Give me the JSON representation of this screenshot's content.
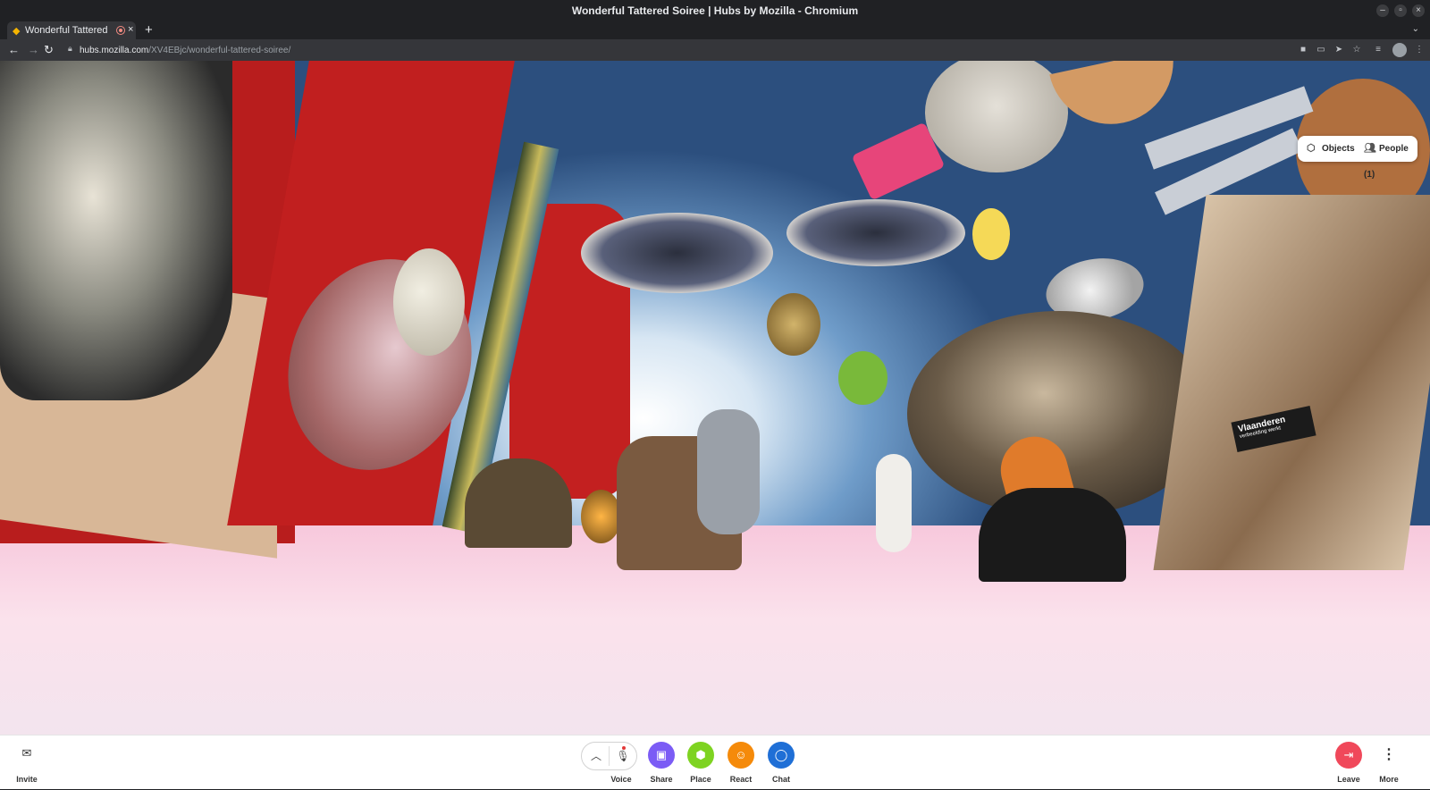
{
  "window": {
    "title": "Wonderful Tattered Soiree | Hubs by Mozilla - Chromium"
  },
  "tab": {
    "label": "Wonderful Tattered Soiree | Hubs by Mozilla"
  },
  "address": {
    "host": "hubs.mozilla.com",
    "path": "/XV4EBjc/wonderful-tattered-soiree/"
  },
  "panel": {
    "objects_label": "Objects",
    "people_label": "People (1)"
  },
  "bottom_bar": {
    "invite_label": "Invite",
    "voice_label": "Voice",
    "share_label": "Share",
    "place_label": "Place",
    "react_label": "React",
    "chat_label": "Chat",
    "leave_label": "Leave",
    "more_label": "More"
  },
  "scene": {
    "sign_text": "Vlaanderen",
    "sign_subtext": "verbeelding werkt"
  },
  "colors": {
    "share": "#7b5cf5",
    "place": "#7ed321",
    "react": "#f58a0a",
    "chat": "#1f6fd6",
    "leave": "#f0485a",
    "floor": "#f7c8dc",
    "sky": "#2c4f7e"
  },
  "icons": {
    "invite": "envelope-icon",
    "voice_toggle": "chevron-up-icon",
    "voice": "muted-microphone-icon",
    "share": "screen-share-icon",
    "place": "cube-icon",
    "react": "smiley-icon",
    "chat": "chat-bubble-icon",
    "leave": "exit-door-icon",
    "more": "vertical-dots-icon",
    "objects": "shapes-icon",
    "people": "people-icon"
  }
}
